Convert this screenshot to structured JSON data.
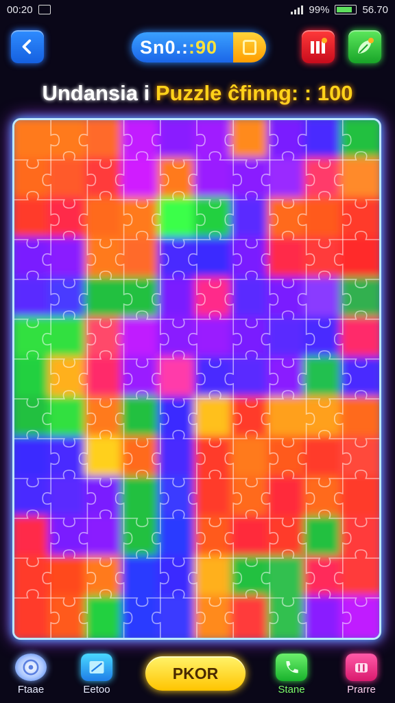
{
  "status_bar": {
    "time": "00:20",
    "battery_percent": "99%",
    "right_text": "56.70"
  },
  "header": {
    "score_label": "Sn0.:",
    "score_value": ":90",
    "back_icon": "chevron-left-icon",
    "coin_icon": "coin-icon",
    "pause_icon": "pause-icon",
    "leaf_icon": "leaf-icon"
  },
  "title": {
    "part1": "Undansia i ",
    "part2": "Puzzle ",
    "part3": "ĉfinng: : 100"
  },
  "board": {
    "columns": 10,
    "rows": 13,
    "piece_colors_rows": [
      [
        "#ff7a1a",
        "#ff7a1a",
        "#ff6a2a",
        "#c21cff",
        "#8a1cff",
        "#a01cff",
        "#ff8a1a",
        "#7a1cff",
        "#4a2aff",
        "#20c040"
      ],
      [
        "#ff6a1a",
        "#ff5a2a",
        "#ff3a3a",
        "#d01cff",
        "#ff7a1a",
        "#9a1cff",
        "#8a1cff",
        "#9a2aff",
        "#ff3a6a",
        "#ff8a2a"
      ],
      [
        "#ff3a2a",
        "#ff2a4a",
        "#ff6a1a",
        "#ff7a1a",
        "#3aff4a",
        "#20d040",
        "#5a2aff",
        "#ff6a1a",
        "#ff5a1a",
        "#ff3a2a"
      ],
      [
        "#7a1cff",
        "#8a1cff",
        "#ff7a1a",
        "#ff6a2a",
        "#4a2aff",
        "#3a2aff",
        "#7a1cff",
        "#ff2a4a",
        "#ff3a3a",
        "#ff2a2a"
      ],
      [
        "#5a2aff",
        "#4a3aff",
        "#20c040",
        "#20c040",
        "#7a1cff",
        "#ff2a8a",
        "#5a2aff",
        "#7a1cff",
        "#8a3aff",
        "#30b050"
      ],
      [
        "#30e040",
        "#30e040",
        "#ff4a6a",
        "#c01cff",
        "#8a1cff",
        "#9a1cff",
        "#7a1cff",
        "#5a2aff",
        "#4a2aff",
        "#ff2a6a"
      ],
      [
        "#20d040",
        "#ffb01a",
        "#ff2a6a",
        "#9a1cff",
        "#ff3aaa",
        "#4a2aff",
        "#5a2aff",
        "#8a1cff",
        "#20c050",
        "#4a2aff"
      ],
      [
        "#20c040",
        "#30e040",
        "#ff7a1a",
        "#20c040",
        "#3a2aff",
        "#ffc01a",
        "#ff3a2a",
        "#ffa01a",
        "#ffa01a",
        "#ff6a1a"
      ],
      [
        "#3a2aff",
        "#4a2aff",
        "#ffd01a",
        "#ff6a1a",
        "#4a2aff",
        "#ff3a2a",
        "#ff7a1a",
        "#ff5a1a",
        "#ff3a2a",
        "#ff4a3a"
      ],
      [
        "#4a2aff",
        "#5a2aff",
        "#7a1cff",
        "#20c040",
        "#3a3aff",
        "#ff3a2a",
        "#ff6a1a",
        "#ff2a3a",
        "#ff6a1a",
        "#ff3a2a"
      ],
      [
        "#ff2a4a",
        "#7a1cff",
        "#8a1cff",
        "#20c040",
        "#2a3aff",
        "#ff5a1a",
        "#ff2a3a",
        "#ff3a2a",
        "#20c040",
        "#ff3a3a"
      ],
      [
        "#ff3a2a",
        "#ff4a1a",
        "#ff7a1a",
        "#2a3aff",
        "#3a2aff",
        "#ffb01a",
        "#20c040",
        "#30c050",
        "#ff2a5a",
        "#ff3a3a"
      ],
      [
        "#ff3a2a",
        "#ff5a1a",
        "#20d040",
        "#2a3aff",
        "#3a3aff",
        "#ff8a1a",
        "#ff3a3a",
        "#30c050",
        "#8a1cff",
        "#c01cff"
      ]
    ]
  },
  "bottom_nav": {
    "items": [
      {
        "label": "Ftaae",
        "icon": "disc-icon"
      },
      {
        "label": "Eetoo",
        "icon": "picture-icon"
      },
      {
        "label": "Stane",
        "icon": "phone-icon"
      },
      {
        "label": "Prarre",
        "icon": "chest-icon"
      }
    ],
    "play_label": "PKOR"
  }
}
